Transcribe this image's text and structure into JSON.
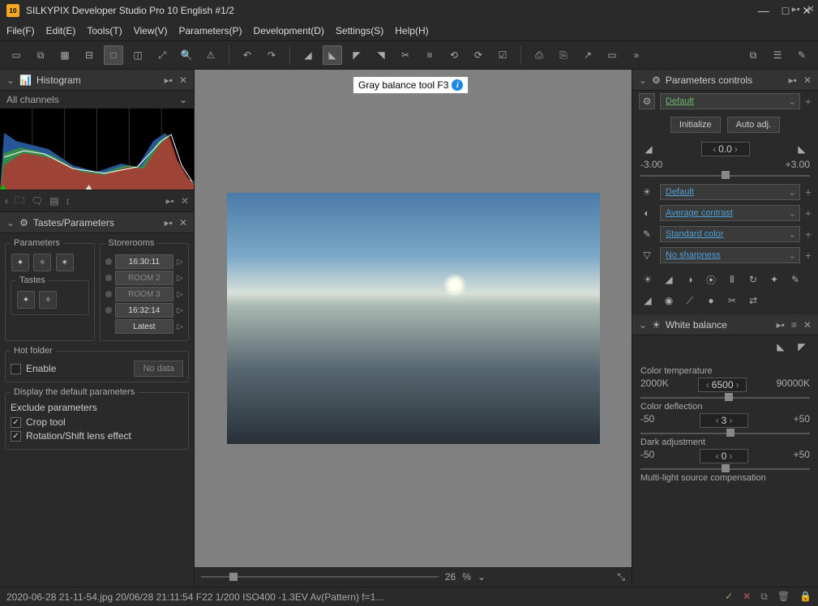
{
  "window": {
    "title": "SILKYPIX Developer Studio Pro 10 English   #1/2",
    "logo_text": "10"
  },
  "menu": {
    "file": "File(F)",
    "edit": "Edit(E)",
    "tools": "Tools(T)",
    "view": "View(V)",
    "parameters": "Parameters(P)",
    "development": "Development(D)",
    "settings": "Settings(S)",
    "help": "Help(H)"
  },
  "tooltip": {
    "text": "Gray balance tool F3"
  },
  "histogram": {
    "title": "Histogram",
    "channels_label": "All channels"
  },
  "tastes_panel": {
    "title": "Tastes/Parameters",
    "parameters_legend": "Parameters",
    "tastes_legend": "Tastes",
    "storerooms_legend": "Storerooms",
    "storerooms": [
      {
        "label": "16:30:11",
        "lit": true
      },
      {
        "label": "ROOM 2",
        "lit": false
      },
      {
        "label": "ROOM 3",
        "lit": false
      },
      {
        "label": "16:32:14",
        "lit": true
      }
    ],
    "latest_label": "Latest"
  },
  "hot_folder": {
    "legend": "Hot folder",
    "enable_label": "Enable",
    "no_data_label": "No data"
  },
  "display_defaults": {
    "legend": "Display the default parameters",
    "exclude_label": "Exclude parameters",
    "crop_label": "Crop tool",
    "rotation_label": "Rotation/Shift lens effect"
  },
  "zoom": {
    "value": "26",
    "unit": "%"
  },
  "params_panel": {
    "title": "Parameters controls",
    "preset_dropdown": "Default",
    "initialize_btn": "Initialize",
    "auto_adj_btn": "Auto adj.",
    "exposure": {
      "value": "0.0",
      "min": "-3.00",
      "max": "+3.00"
    },
    "wb_dropdown": "Default",
    "contrast_dropdown": "Average contrast",
    "color_dropdown": "Standard color",
    "sharp_dropdown": "No sharpness"
  },
  "white_balance": {
    "title": "White balance",
    "color_temp_label": "Color temperature",
    "color_temp": {
      "value": "6500",
      "min": "2000K",
      "max": "90000K"
    },
    "color_defl_label": "Color deflection",
    "color_defl": {
      "value": "3",
      "min": "-50",
      "max": "+50"
    },
    "dark_adj_label": "Dark adjustment",
    "dark_adj": {
      "value": "0",
      "min": "-50",
      "max": "+50"
    },
    "multi_light_label": "Multi-light source compensation"
  },
  "statusbar": {
    "text": "2020-06-28 21-11-54.jpg 20/06/28 21:11:54 F22 1/200 ISO400 -1.3EV Av(Pattern) f=1..."
  }
}
